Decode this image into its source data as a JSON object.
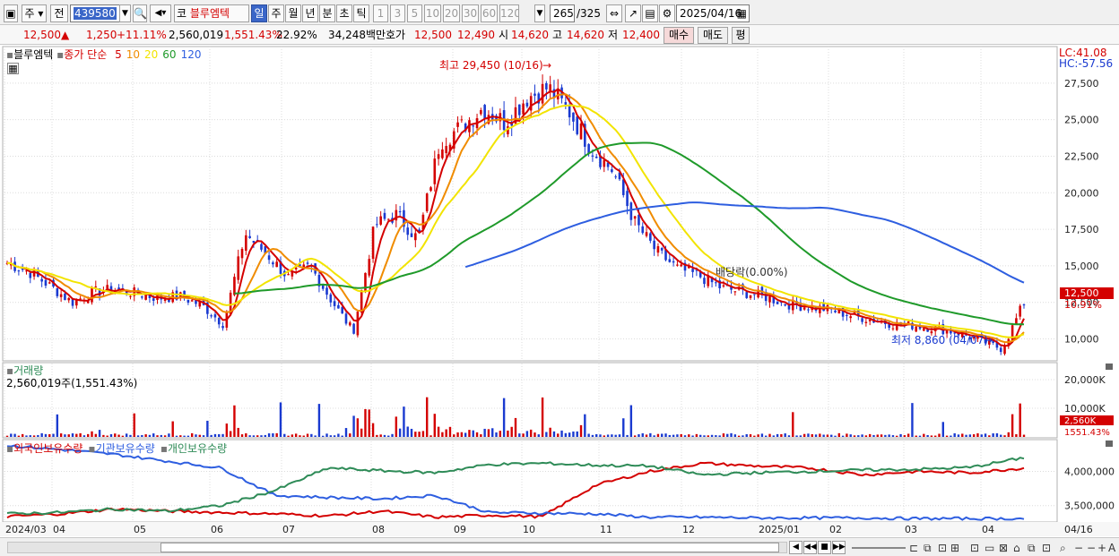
{
  "toolbar": {
    "market": "주",
    "scope": "전",
    "code": "439580",
    "stock_name": "블루엠텍",
    "name_prefix": "코",
    "periods": [
      "일",
      "주",
      "월",
      "년",
      "분",
      "초",
      "틱"
    ],
    "selected_period": "일",
    "intervals": [
      "1",
      "3",
      "5",
      "10",
      "20",
      "30",
      "60",
      "120"
    ],
    "count": "265",
    "total": "/325",
    "date": "2025/04/16"
  },
  "quote": {
    "price": "12,500",
    "price_arrow": "▲",
    "change": "1,250",
    "change_pct": "+11.11%",
    "volume": "2,560,019",
    "volume_pct": "1,551.43%",
    "turnover_pct": "22.92%",
    "amount": "34,248백만",
    "bid_label": "호가",
    "ask_price": "12,500",
    "bid_price": "12,490",
    "open_label": "시",
    "open": "14,620",
    "high_label": "고",
    "high": "14,620",
    "low_label": "저",
    "low": "12,400",
    "buy_label": "매수",
    "sell_label": "매도",
    "eval_label": "평"
  },
  "price_panel": {
    "legend_name": "블루엠텍",
    "legend_ma": "종가 단순",
    "ma_periods": [
      {
        "label": "5",
        "color": "#d40000"
      },
      {
        "label": "10",
        "color": "#f08c00"
      },
      {
        "label": "20",
        "color": "#f2e400"
      },
      {
        "label": "60",
        "color": "#1f9a2a"
      },
      {
        "label": "120",
        "color": "#2e5ee0"
      }
    ],
    "lc": "LC:41.08",
    "hc": "HC:-57.56",
    "high_note": "최고 29,450 (10/16)",
    "low_note": "최저 8,860 (04/07)",
    "dividend_note": "배당락(0.00%)",
    "current_tag": "12,500",
    "current_pct": "10.91%"
  },
  "volume_panel": {
    "title": "거래량",
    "value": "2,560,019주(1,551.43%)",
    "current_tag": "2,560K",
    "current_pct": "1551.43%"
  },
  "holding_panel": {
    "legend": [
      {
        "label": "외국인보유수량",
        "color": "#d40000"
      },
      {
        "label": "기관보유수량",
        "color": "#2e5ee0"
      },
      {
        "label": "개인보유수량",
        "color": "#2e8b57"
      }
    ]
  },
  "chart_data": [
    {
      "type": "candlestick",
      "title": "블루엠텍",
      "x_ticks": [
        "2024/03",
        "04",
        "05",
        "06",
        "07",
        "08",
        "09",
        "10",
        "11",
        "12",
        "2025/01",
        "02",
        "03",
        "04",
        "04/16"
      ],
      "y_ticks": [
        10000,
        12500,
        15000,
        17500,
        20000,
        22500,
        25000,
        27500
      ],
      "y_tick_labels": [
        "10,000",
        "12,500",
        "15,000",
        "17,500",
        "20,000",
        "22,500",
        "25,000",
        "27,500"
      ],
      "ylim": [
        8500,
        30000
      ],
      "close_approx": [
        15200,
        14600,
        13600,
        12500,
        13200,
        13400,
        13100,
        12800,
        12900,
        12300,
        11000,
        17200,
        15800,
        14200,
        15000,
        12600,
        10500,
        17800,
        18500,
        16800,
        23500,
        24500,
        25800,
        24800,
        26500,
        27200,
        25500,
        23000,
        21500,
        18000,
        16000,
        14800,
        14300,
        13500,
        13200,
        12900,
        12400,
        12200,
        12000,
        11600,
        11300,
        11000,
        10900,
        10700,
        10400,
        9900,
        9300,
        12500
      ],
      "high": 29450,
      "low": 8860
    },
    {
      "type": "bar",
      "title": "거래량",
      "y_ticks": [
        10000,
        20000
      ],
      "y_tick_labels": [
        "10,000K",
        "20,000K"
      ],
      "ylim": [
        0,
        25000
      ]
    },
    {
      "type": "line",
      "y_ticks": [
        3500000,
        4000000
      ],
      "y_tick_labels": [
        "3,500,000",
        "4,000,000"
      ],
      "series": [
        {
          "name": "외국인보유수량"
        },
        {
          "name": "기관보유수량"
        },
        {
          "name": "개인보유수량"
        }
      ]
    }
  ]
}
